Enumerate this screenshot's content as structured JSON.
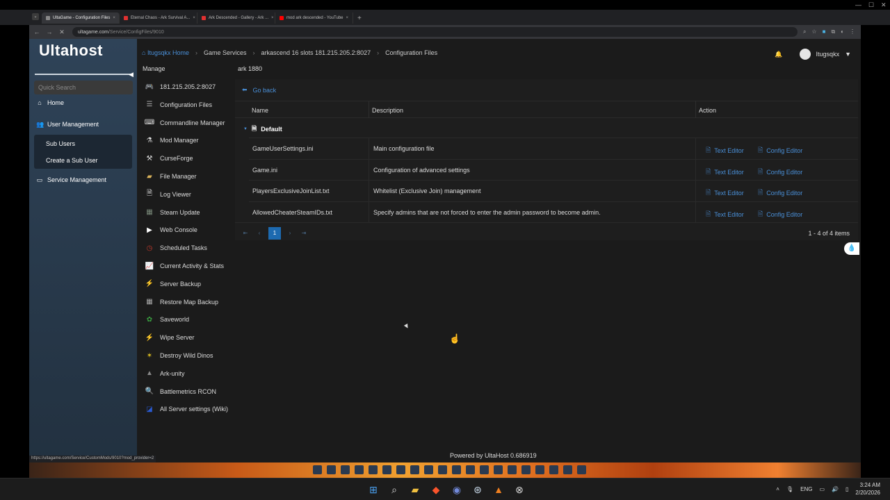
{
  "browser": {
    "tabs": [
      {
        "title": "UltaGame - Configuration Files",
        "color": "#888888",
        "active": true
      },
      {
        "title": "Eternal Chaos - Ark Survival A...",
        "color": "#e03030",
        "active": false
      },
      {
        "title": "Ark Descended - Gallery - Ark ...",
        "color": "#e03030",
        "active": false
      },
      {
        "title": "mod ark descended - YouTube",
        "color": "#ff0000",
        "active": false
      }
    ],
    "url_host": "ultagame.com",
    "url_path": "/Service/ConfigFiles/9010",
    "status_url": "https://ultagame.com/Service/CustomMods/9010?mod_provider=2"
  },
  "sidebar": {
    "logo": "Ultahost",
    "search_placeholder": "Quick Search",
    "home": "Home",
    "user_management": "User Management",
    "sub_users": "Sub Users",
    "create_sub_user": "Create a Sub User",
    "service_management": "Service Management"
  },
  "manage": {
    "title": "Manage",
    "items": [
      {
        "label": "181.215.205.2:8027",
        "icon": "gamepad-icon",
        "color": "#2ecc40"
      },
      {
        "label": "Configuration Files",
        "icon": "sliders-icon",
        "color": "#aaaaaa"
      },
      {
        "label": "Commandline Manager",
        "icon": "keyboard-icon",
        "color": "#dddddd"
      },
      {
        "label": "Mod Manager",
        "icon": "flask-icon",
        "color": "#dddddd"
      },
      {
        "label": "CurseForge",
        "icon": "hammer-icon",
        "color": "#dddddd"
      },
      {
        "label": "File Manager",
        "icon": "folder-icon",
        "color": "#d9b25a"
      },
      {
        "label": "Log Viewer",
        "icon": "document-icon",
        "color": "#dddddd"
      },
      {
        "label": "Steam Update",
        "icon": "steam-icon",
        "color": "#7a8a7a"
      },
      {
        "label": "Web Console",
        "icon": "terminal-icon",
        "color": "#ffffff"
      },
      {
        "label": "Scheduled Tasks",
        "icon": "clock-icon",
        "color": "#c0392b"
      },
      {
        "label": "Current Activity & Stats",
        "icon": "chart-icon",
        "color": "#dddddd"
      },
      {
        "label": "Server Backup",
        "icon": "lightning-icon",
        "color": "#f1e00a"
      },
      {
        "label": "Restore Map Backup",
        "icon": "map-icon",
        "color": "#aaaaaa"
      },
      {
        "label": "Saveworld",
        "icon": "globe-icon",
        "color": "#3aa040"
      },
      {
        "label": "Wipe Server",
        "icon": "lightning-icon",
        "color": "#f1e00a"
      },
      {
        "label": "Destroy Wild Dinos",
        "icon": "dino-icon",
        "color": "#e0c020"
      },
      {
        "label": "Ark-unity",
        "icon": "ark-icon",
        "color": "#888888"
      },
      {
        "label": "Battlemetrics RCON",
        "icon": "magnifier-icon",
        "color": "#ffffff"
      },
      {
        "label": "All Server settings (Wiki)",
        "icon": "wiki-icon",
        "color": "#2a5ad0"
      }
    ]
  },
  "breadcrumb": {
    "home": "Itugsqkx Home",
    "items": [
      "Game Services",
      "arkascend 16 slots 181.215.205.2:8027",
      "Configuration Files"
    ]
  },
  "user": {
    "name": "Itugsqkx"
  },
  "server_name": "ark 1880",
  "table": {
    "go_back": "Go back",
    "headers": {
      "name": "Name",
      "description": "Description",
      "action": "Action"
    },
    "group": "Default",
    "rows": [
      {
        "name": "GameUserSettings.ini",
        "description": "Main configuration file"
      },
      {
        "name": "Game.ini",
        "description": "Configuration of advanced settings"
      },
      {
        "name": "PlayersExclusiveJoinList.txt",
        "description": "Whitelist (Exclusive Join) management"
      },
      {
        "name": "AllowedCheaterSteamIDs.txt",
        "description": "Specify admins that are not forced to enter the admin password to become admin."
      }
    ],
    "text_editor": "Text Editor",
    "config_editor": "Config Editor",
    "page": "1",
    "page_info": "1 - 4 of 4 items"
  },
  "footer": "Powered by UltaHost 0.686919",
  "taskbar": {
    "lang": "ENG",
    "time": "3:24 AM",
    "date": "2/20/2026"
  }
}
